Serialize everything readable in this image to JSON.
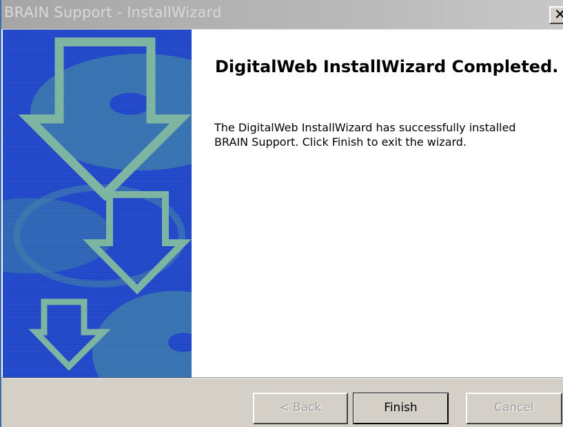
{
  "window": {
    "title": "BRAIN Support - InstallWizard",
    "close_glyph": "✕"
  },
  "sidebar": {
    "graphic": "down-arrows-graphic"
  },
  "content": {
    "heading": "DigitalWeb InstallWizard Completed.",
    "message": "The DigitalWeb InstallWizard has successfully installed BRAIN Support. Click Finish to exit the wizard."
  },
  "buttons": {
    "back": "< Back",
    "finish": "Finish",
    "cancel": "Cancel"
  },
  "colors": {
    "sidebar_blue": "#1e44c8",
    "arrow_green": "#6fa898",
    "disc_teal": "#3d7fa8",
    "dialog_face": "#d4d0c8"
  }
}
